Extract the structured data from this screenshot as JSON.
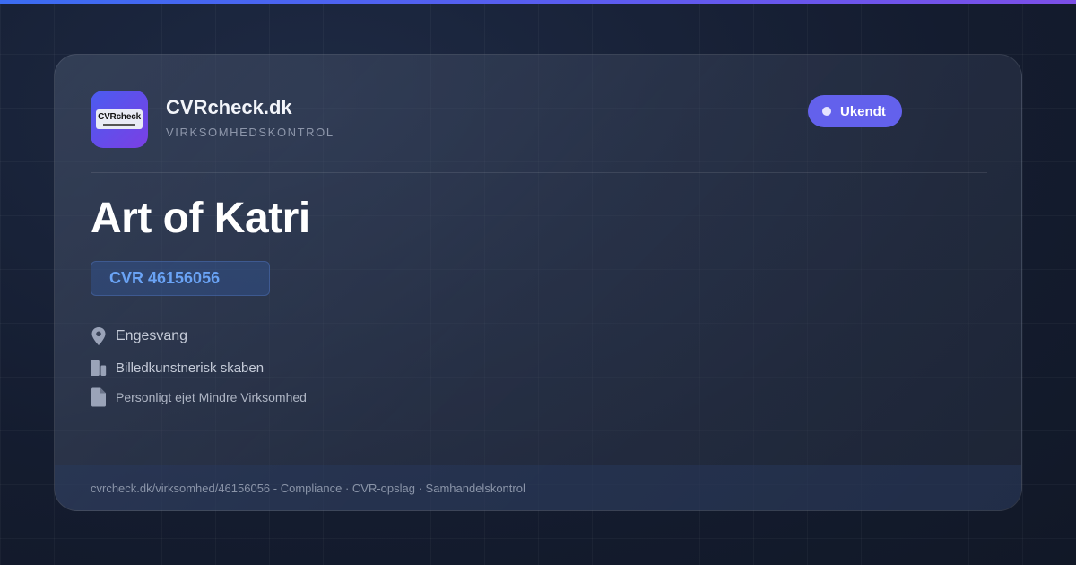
{
  "brand": {
    "logo_text": "CVRcheck",
    "name": "CVRcheck.dk",
    "tagline": "VIRKSOMHEDSKONTROL"
  },
  "status": {
    "label": "Ukendt"
  },
  "company": {
    "name": "Art of Katri",
    "cvr": "CVR 46156056",
    "location": "Engesvang",
    "industry": "Billedkunstnerisk skaben",
    "company_type": "Personligt ejet Mindre Virksomhed"
  },
  "footer": {
    "text": "cvrcheck.dk/virksomhed/46156056 - Compliance · CVR-opslag · Samhandelskontrol"
  },
  "icons": {
    "location": "map-pin-icon",
    "industry": "building-icon",
    "company_type": "document-icon"
  },
  "colors": {
    "accent_gradient_start": "#3b6cf2",
    "accent_gradient_end": "#7c4fe8",
    "status_badge": "#6361ec",
    "cvr_text": "#6aa3f5"
  }
}
